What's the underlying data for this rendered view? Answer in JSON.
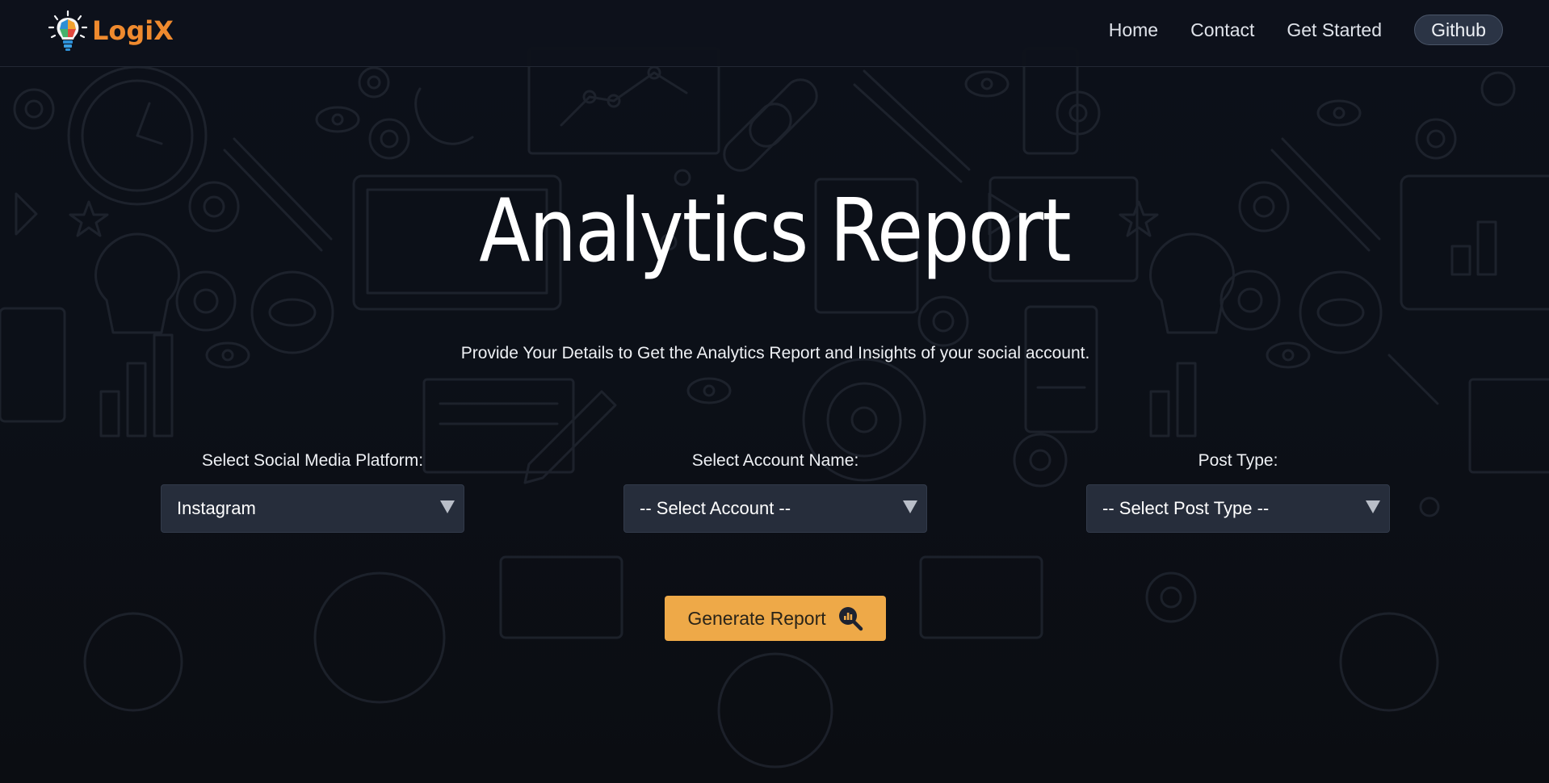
{
  "brand": {
    "name": "LogiX"
  },
  "nav": {
    "links": [
      "Home",
      "Contact",
      "Get Started"
    ],
    "github_label": "Github"
  },
  "hero": {
    "title": "Analytics Report",
    "description": "Provide Your Details to Get the Analytics Report and Insights of your social account."
  },
  "form": {
    "platform": {
      "label": "Select Social Media Platform:",
      "selected": "Instagram"
    },
    "account": {
      "label": "Select Account Name:",
      "selected": "-- Select Account --"
    },
    "post_type": {
      "label": "Post Type:",
      "selected": "-- Select Post Type --"
    },
    "submit_label": "Generate Report"
  },
  "colors": {
    "background": "#0c1019",
    "accent": "#eea948",
    "brand": "#ef8a2e",
    "select_bg": "#262d3b",
    "github_pill": "#2b3445"
  },
  "icons": {
    "brand": "lightbulb-puzzle-logo",
    "select_arrow": "triangle-down-icon",
    "submit": "chart-magnifier-icon"
  }
}
